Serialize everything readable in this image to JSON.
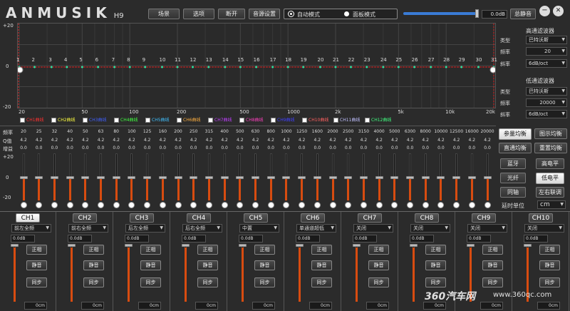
{
  "app": {
    "logo": "ANMUSIK",
    "model": "H9"
  },
  "toolbar": {
    "scene": "场景",
    "options": "选项",
    "disconnect": "断开",
    "audio_settings": "音源设置",
    "auto_mode": "自动模式",
    "panel_mode": "面板模式",
    "master_db": "0.0dB",
    "master_mute": "总静音"
  },
  "graph": {
    "y_top": "+20",
    "y_mid": "0",
    "y_bot": "-20",
    "points": [
      "1",
      "2",
      "3",
      "4",
      "5",
      "6",
      "7",
      "8",
      "9",
      "10",
      "11",
      "12",
      "13",
      "14",
      "15",
      "16",
      "17",
      "18",
      "19",
      "20",
      "21",
      "22",
      "23",
      "24",
      "25",
      "26",
      "27",
      "28",
      "29",
      "30",
      "31"
    ],
    "x_ticks": [
      "20",
      "50",
      "100",
      "200",
      "500",
      "1000",
      "2k",
      "5k",
      "10k",
      "20k"
    ]
  },
  "legend": [
    {
      "label": "CH1曲线",
      "color": "#ff3030"
    },
    {
      "label": "CH2曲线",
      "color": "#ffff40"
    },
    {
      "label": "CH3曲线",
      "color": "#4060ff"
    },
    {
      "label": "CH4曲线",
      "color": "#40ff40"
    },
    {
      "label": "CH5曲线",
      "color": "#40c0ff"
    },
    {
      "label": "CH6曲线",
      "color": "#ffb040"
    },
    {
      "label": "CH7曲线",
      "color": "#c040ff"
    },
    {
      "label": "CH8曲线",
      "color": "#ff40c0"
    },
    {
      "label": "CH9曲线",
      "color": "#4040ff"
    },
    {
      "label": "CH10曲线",
      "color": "#ff6060"
    },
    {
      "label": "CH11曲线",
      "color": "#c0c0ff"
    },
    {
      "label": "CH12曲线",
      "color": "#40ff80"
    }
  ],
  "highpass": {
    "title": "高通滤波器",
    "type_label": "类型",
    "type_value": "巴特沃斯",
    "freq_label": "频率",
    "freq_value": "20",
    "slope_label": "斜率",
    "slope_value": "6dB/oct"
  },
  "lowpass": {
    "title": "低通滤波器",
    "type_label": "类型",
    "type_value": "巴特沃斯",
    "freq_label": "频率",
    "freq_value": "20000",
    "slope_label": "斜率",
    "slope_value": "6dB/oct"
  },
  "eq": {
    "freq_label": "频率",
    "q_label": "Q值",
    "gain_label": "增益",
    "freqs": [
      "20",
      "25",
      "32",
      "40",
      "50",
      "63",
      "80",
      "100",
      "125",
      "160",
      "200",
      "250",
      "315",
      "400",
      "500",
      "630",
      "800",
      "1000",
      "1250",
      "1600",
      "2000",
      "2500",
      "3150",
      "4000",
      "5000",
      "6300",
      "8000",
      "10000",
      "12500",
      "16000",
      "20000"
    ],
    "q": [
      "4.2",
      "4.2",
      "4.2",
      "4.2",
      "4.2",
      "4.2",
      "4.2",
      "4.2",
      "4.2",
      "4.2",
      "4.2",
      "4.2",
      "4.2",
      "4.2",
      "4.2",
      "4.2",
      "4.2",
      "4.2",
      "4.2",
      "4.2",
      "4.2",
      "4.2",
      "4.2",
      "4.2",
      "4.2",
      "4.2",
      "4.2",
      "4.2",
      "4.2",
      "4.2",
      "4.2"
    ],
    "gain": [
      "0.0",
      "0.0",
      "0.0",
      "0.0",
      "0.0",
      "0.0",
      "0.0",
      "0.0",
      "0.0",
      "0.0",
      "0.0",
      "0.0",
      "0.0",
      "0.0",
      "0.0",
      "0.0",
      "0.0",
      "0.0",
      "0.0",
      "0.0",
      "0.0",
      "0.0",
      "0.0",
      "0.0",
      "0.0",
      "0.0",
      "0.0",
      "0.0",
      "0.0",
      "0.0",
      "0.0"
    ],
    "scale_top": "+20",
    "scale_mid": "0",
    "scale_bot": "-20"
  },
  "eq_buttons": {
    "param_eq": "参量均衡",
    "graphic_eq": "图示均衡",
    "bypass_eq": "直通均衡",
    "reset_eq": "重置均衡"
  },
  "side_buttons": {
    "bluetooth": "蓝牙",
    "high_level": "高电平",
    "optical": "光纤",
    "low_level": "低电平",
    "coax": "同轴",
    "lr_link": "左右联调",
    "delay_unit_label": "延时单位",
    "delay_unit_value": "cm"
  },
  "channels": [
    {
      "name": "CH1",
      "pos": "前左全频",
      "db": "0.0dB",
      "phase": "正相",
      "mute": "静音",
      "sync": "同步",
      "dist": "0cm"
    },
    {
      "name": "CH2",
      "pos": "前右全频",
      "db": "0.0dB",
      "phase": "正相",
      "mute": "静音",
      "sync": "同步",
      "dist": "0cm"
    },
    {
      "name": "CH3",
      "pos": "后左全频",
      "db": "0.0dB",
      "phase": "正相",
      "mute": "静音",
      "sync": "同步",
      "dist": "0cm"
    },
    {
      "name": "CH4",
      "pos": "后右全频",
      "db": "0.0dB",
      "phase": "正相",
      "mute": "静音",
      "sync": "同步",
      "dist": "0cm"
    },
    {
      "name": "CH5",
      "pos": "中置",
      "db": "0.0dB",
      "phase": "正相",
      "mute": "静音",
      "sync": "同步",
      "dist": "0cm"
    },
    {
      "name": "CH6",
      "pos": "单通道超低",
      "db": "0.0dB",
      "phase": "正相",
      "mute": "静音",
      "sync": "同步",
      "dist": "0cm"
    },
    {
      "name": "CH7",
      "pos": "关闭",
      "db": "0.0dB",
      "phase": "正相",
      "mute": "静音",
      "sync": "同步",
      "dist": "0cm"
    },
    {
      "name": "CH8",
      "pos": "关闭",
      "db": "0.0dB",
      "phase": "正相",
      "mute": "静音",
      "sync": "同步",
      "dist": "0cm"
    },
    {
      "name": "CH9",
      "pos": "关闭",
      "db": "0.0dB",
      "phase": "正相",
      "mute": "静音",
      "sync": "同步",
      "dist": "0cm"
    },
    {
      "name": "CH10",
      "pos": "关闭",
      "db": "0.0dB",
      "phase": "正相",
      "mute": "静音",
      "sync": "同步",
      "dist": "0cm"
    }
  ],
  "watermark": {
    "brand": "360汽车网",
    "url": "www.360qc.com"
  }
}
